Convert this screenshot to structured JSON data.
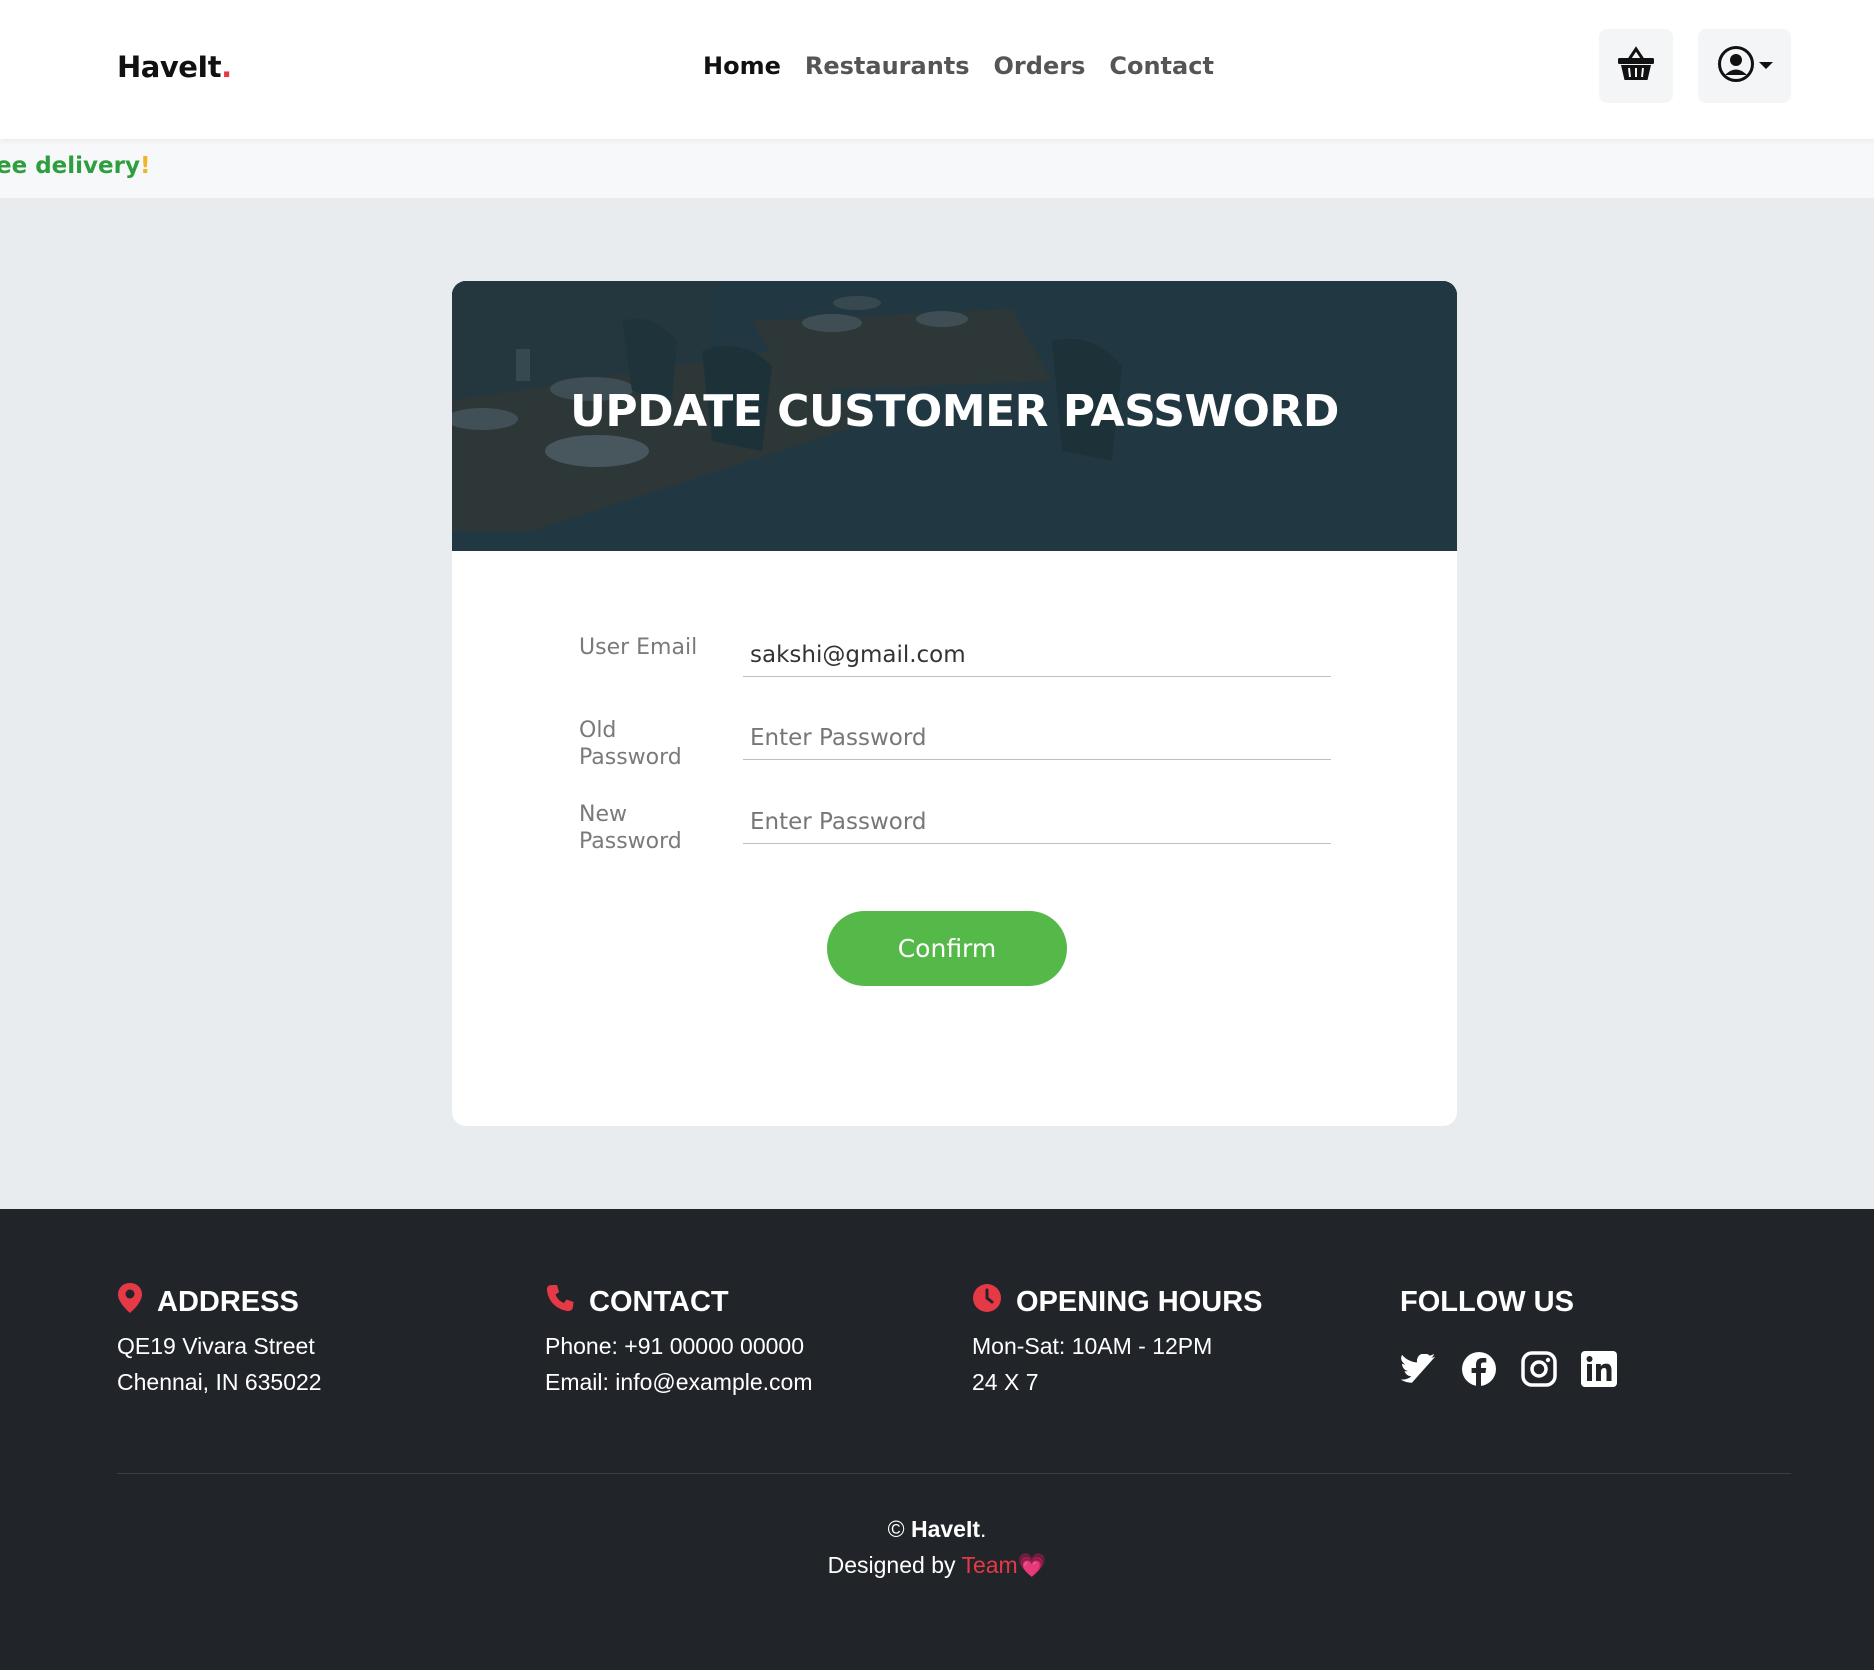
{
  "nav": {
    "brand": "HaveIt",
    "brand_dot": ".",
    "links": [
      "Home",
      "Restaurants",
      "Orders",
      "Contact"
    ]
  },
  "banner": {
    "text": "ee delivery",
    "suffix": "!"
  },
  "card": {
    "title": "UPDATE CUSTOMER PASSWORD",
    "email_label": "User Email",
    "email_value": "sakshi@gmail.com",
    "old_label": "Old Password",
    "old_placeholder": "Enter Password",
    "new_label": "New Password",
    "new_placeholder": "Enter Password",
    "confirm": "Confirm"
  },
  "footer": {
    "address_title": "ADDRESS",
    "address_line1": "QE19 Vivara Street",
    "address_line2": "Chennai, IN 635022",
    "contact_title": "CONTACT",
    "phone": "Phone: +91 00000 00000",
    "email": "Email: info@example.com",
    "hours_title": "OPENING HOURS",
    "hours_line1": "Mon-Sat: 10AM - 12PM",
    "hours_line2": "24 X 7",
    "follow_title": "FOLLOW US",
    "copy_symbol": "©",
    "copy_brand": "HaveIt",
    "copy_dot": ".",
    "designed_by": "Designed by",
    "team": "Team",
    "heart": "💗"
  },
  "colors": {
    "accent": "#e63946",
    "green": "#55b949",
    "footer_bg": "#212429"
  }
}
